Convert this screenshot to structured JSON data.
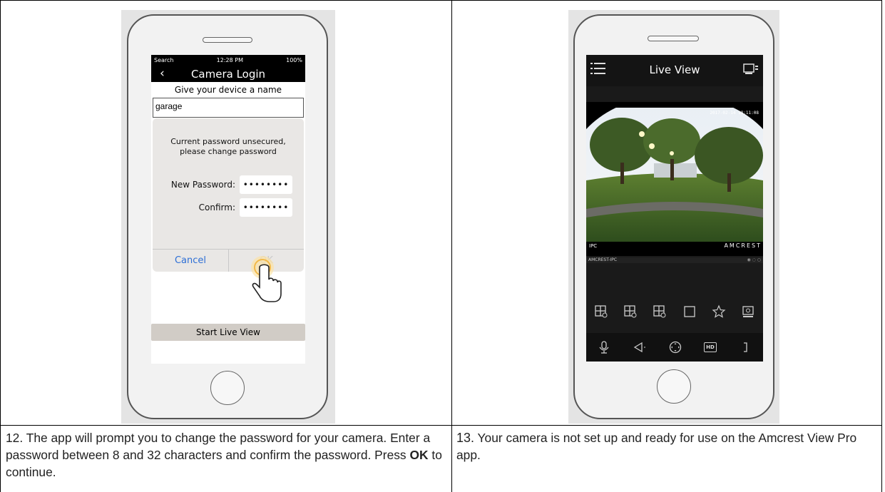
{
  "left_phone": {
    "status_bar": {
      "left": "Search",
      "time": "12:28 PM",
      "right": "100%"
    },
    "title": "Camera Login",
    "prompt": "Give your device a name",
    "device_name": "garage",
    "dialog": {
      "message": "Current password unsecured, please change password",
      "new_password_label": "New Password:",
      "new_password_value": "••••••••",
      "confirm_label": "Confirm:",
      "confirm_value": "••••••••",
      "cancel_label": "Cancel",
      "ok_label": "OK"
    },
    "start_button": "Start Live View"
  },
  "right_phone": {
    "title": "Live View",
    "timestamp": "2017-02-14 18:11:08",
    "channel_label": "IPC",
    "brand_watermark": "AMCREST",
    "device_label": "AMCREST-IPC",
    "top_icons": [
      "layout-4-icon",
      "layout-9-icon",
      "layout-16-icon",
      "single-view-icon",
      "favorite-star-icon",
      "snapshot-icon"
    ],
    "bottom_icons": [
      "microphone-icon",
      "speaker-icon",
      "ptz-icon",
      "hd-icon",
      "more-icon"
    ],
    "hd_label": "HD"
  },
  "captions": {
    "step12": {
      "text_before_bold": "12. The app will prompt you to change the password for your camera. Enter a password between 8 and 32 characters and confirm the password. Press ",
      "bold": "OK",
      "text_after_bold": " to continue."
    },
    "step13": {
      "number": "13.",
      "text": " Your camera is not set up and ready for use on the Amcrest View Pro app."
    }
  }
}
